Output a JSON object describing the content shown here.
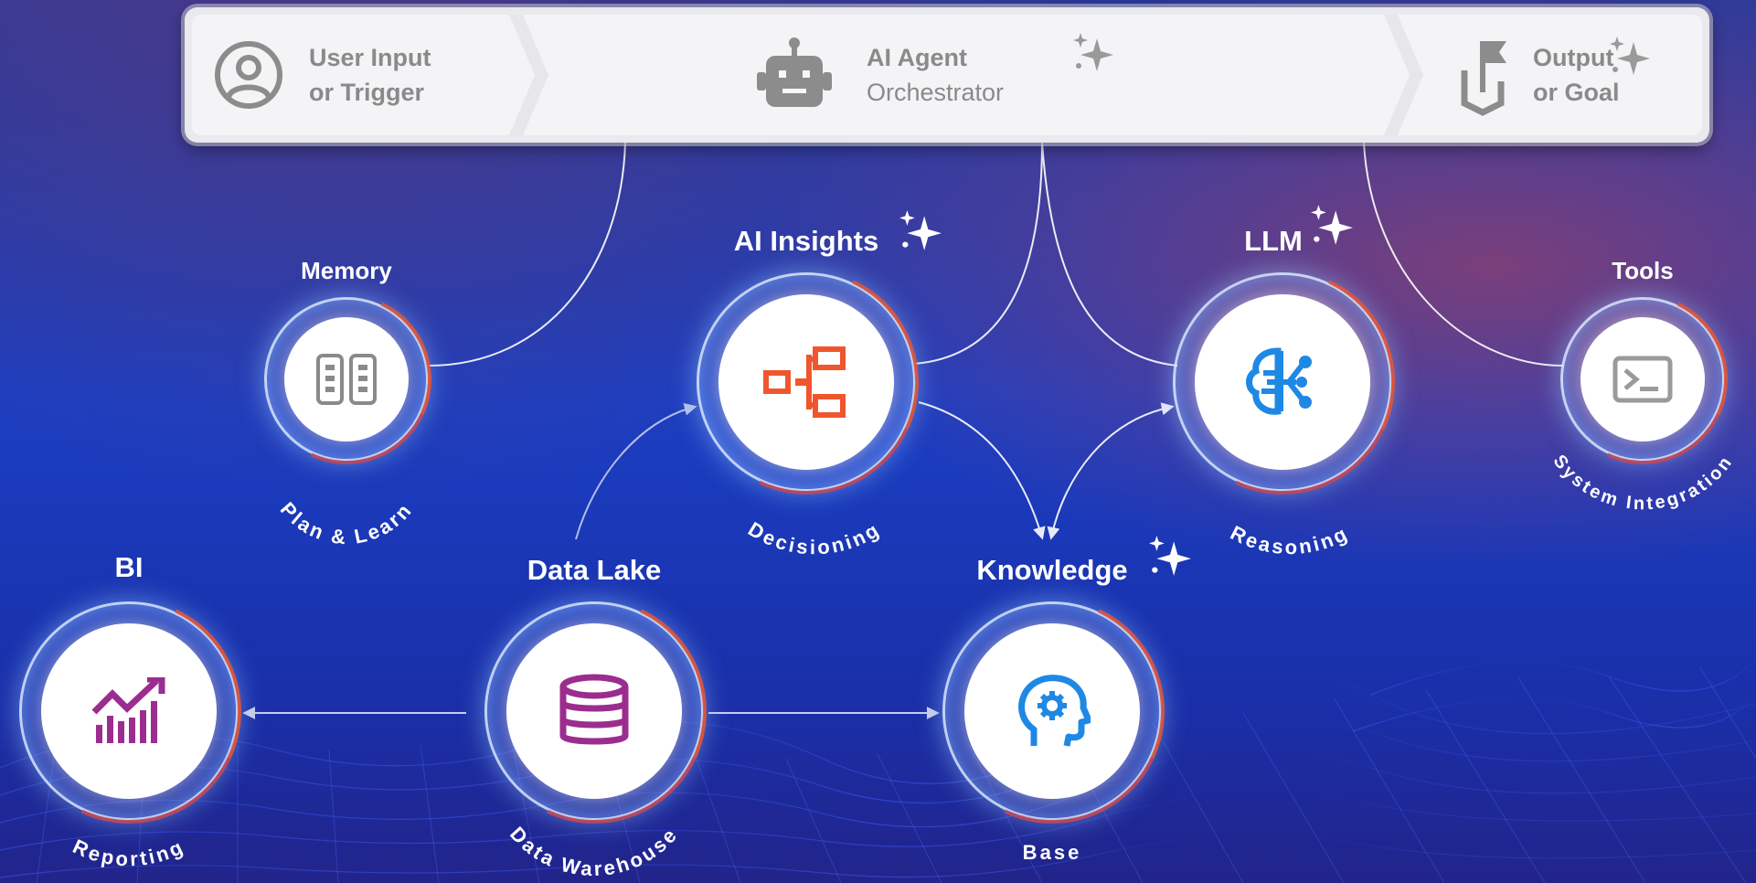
{
  "banner": {
    "user_input": {
      "line1": "User Input",
      "line2": "or Trigger",
      "icon": "user-icon"
    },
    "agent": {
      "line1": "AI Agent",
      "line2": "Orchestrator",
      "icon": "robot-icon"
    },
    "output": {
      "line1": "Output",
      "line2": "or Goal",
      "icon": "goal-flag-icon"
    }
  },
  "nodes": {
    "memory": {
      "title": "Memory",
      "sub": "Plan & Learn",
      "icon": "memory-columns-icon",
      "color": "#8a8a8a"
    },
    "ai_insights": {
      "title": "AI Insights",
      "sub": "Decisioning",
      "icon": "decision-tree-icon",
      "color": "#f0562e"
    },
    "llm": {
      "title": "LLM",
      "sub": "Reasoning",
      "icon": "brain-network-icon",
      "color": "#1e88e5"
    },
    "tools": {
      "title": "Tools",
      "sub": "System Integration",
      "icon": "terminal-icon",
      "color": "#9a9a9a"
    },
    "bi": {
      "title": "BI",
      "sub": "Reporting",
      "icon": "chart-icon",
      "color": "#9b2d8f"
    },
    "data_lake": {
      "title": "Data Lake",
      "sub": "Data Warehouse",
      "icon": "database-icon",
      "color": "#9b2d8f"
    },
    "knowledge": {
      "title": "Knowledge",
      "sub": "Base",
      "icon": "head-gear-icon",
      "color": "#1e88e5"
    }
  },
  "colors": {
    "accent_orange": "#e0553a",
    "gray_icon": "#8a8a8a",
    "white": "#ffffff"
  }
}
